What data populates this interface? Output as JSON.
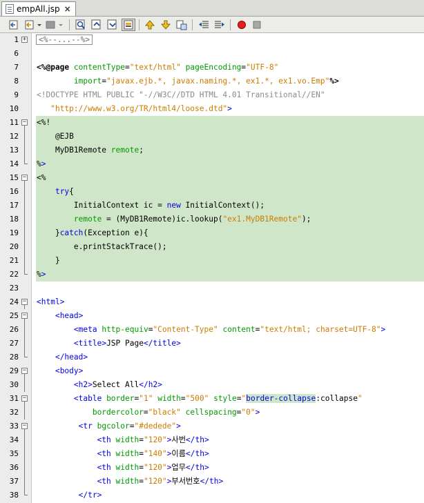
{
  "tab": {
    "label": "empAll.jsp",
    "close": "×"
  },
  "toolbar": {
    "buttons": [
      "last-edit-icon",
      "back-icon",
      "forward-icon",
      "find-icon",
      "find-previous-icon",
      "find-next-icon",
      "toggle-highlight-icon",
      "previous-bookmark-icon",
      "next-bookmark-icon",
      "toggle-bookmark-icon",
      "shift-left-icon",
      "shift-right-icon",
      "record-macro-icon",
      "stop-macro-icon"
    ]
  },
  "colors": {
    "keyword": "#0000e6",
    "string": "#ce7b00",
    "attribute": "#009900",
    "highlight": "#cfe7c8"
  },
  "lines": [
    {
      "n": "1",
      "t": "<%--...--%>"
    },
    {
      "n": "6",
      "t": ""
    },
    {
      "n": "7",
      "t": "<%@page contentType=\"text/html\" pageEncoding=\"UTF-8\""
    },
    {
      "n": "8",
      "t": "        import=\"javax.ejb.*, javax.naming.*, ex1.*, ex1.vo.Emp\"%>"
    },
    {
      "n": "9",
      "t": "<!DOCTYPE HTML PUBLIC \"-//W3C//DTD HTML 4.01 Transitional//EN\""
    },
    {
      "n": "10",
      "t": "   \"http://www.w3.org/TR/html4/loose.dtd\">"
    },
    {
      "n": "11",
      "t": "<%!"
    },
    {
      "n": "12",
      "t": "    @EJB"
    },
    {
      "n": "13",
      "t": "    MyDB1Remote remote;"
    },
    {
      "n": "14",
      "t": "%>"
    },
    {
      "n": "15",
      "t": "<%"
    },
    {
      "n": "16",
      "t": "    try{"
    },
    {
      "n": "17",
      "t": "        InitialContext ic = new InitialContext();"
    },
    {
      "n": "18",
      "t": "        remote = (MyDB1Remote)ic.lookup(\"ex1.MyDB1Remote\");"
    },
    {
      "n": "19",
      "t": "    }catch(Exception e){"
    },
    {
      "n": "20",
      "t": "        e.printStackTrace();"
    },
    {
      "n": "21",
      "t": "    }"
    },
    {
      "n": "22",
      "t": "%>"
    },
    {
      "n": "23",
      "t": ""
    },
    {
      "n": "24",
      "t": "<html>"
    },
    {
      "n": "25",
      "t": "    <head>"
    },
    {
      "n": "26",
      "t": "        <meta http-equiv=\"Content-Type\" content=\"text/html; charset=UTF-8\">"
    },
    {
      "n": "27",
      "t": "        <title>JSP Page</title>"
    },
    {
      "n": "28",
      "t": "    </head>"
    },
    {
      "n": "29",
      "t": "    <body>"
    },
    {
      "n": "30",
      "t": "        <h2>Select All</h2>"
    },
    {
      "n": "31",
      "t": "        <table border=\"1\" width=\"500\" style=\"border-collapse:collapse\""
    },
    {
      "n": "32",
      "t": "            bordercolor=\"black\" cellspacing=\"0\">"
    },
    {
      "n": "33",
      "t": "         <tr bgcolor=\"#dedede\">"
    },
    {
      "n": "34",
      "t": "             <th width=\"120\">사번</th>"
    },
    {
      "n": "35",
      "t": "             <th width=\"140\">이름</th>"
    },
    {
      "n": "36",
      "t": "             <th width=\"120\">업무</th>"
    },
    {
      "n": "37",
      "t": "             <th width=\"120\">부서번호</th>"
    },
    {
      "n": "38",
      "t": "         </tr>"
    }
  ]
}
